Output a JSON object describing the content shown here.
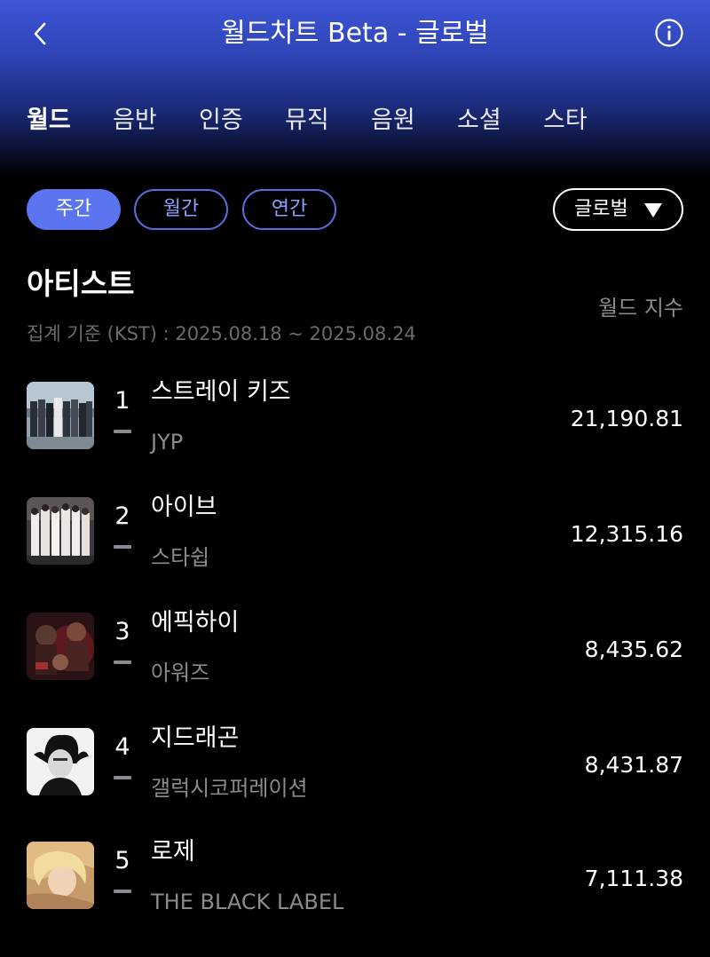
{
  "header": {
    "title": "월드차트 Beta - 글로벌"
  },
  "tabs": [
    {
      "label": "월드"
    },
    {
      "label": "음반"
    },
    {
      "label": "인증"
    },
    {
      "label": "뮤직"
    },
    {
      "label": "음원"
    },
    {
      "label": "소셜"
    },
    {
      "label": "스타"
    }
  ],
  "period_filter": {
    "options": [
      "주간",
      "월간",
      "연간"
    ],
    "selected": "주간"
  },
  "region_dropdown": {
    "value": "글로벌"
  },
  "section": {
    "title": "아티스트",
    "period_text": "집계 기준 (KST) : 2025.08.18 ~ 2025.08.24",
    "column_header": "월드 지수"
  },
  "rows": [
    {
      "rank": "1",
      "name": "스트레이 키즈",
      "agency": "JYP",
      "score": "21,190.81"
    },
    {
      "rank": "2",
      "name": "아이브",
      "agency": "스타쉽",
      "score": "12,315.16"
    },
    {
      "rank": "3",
      "name": "에픽하이",
      "agency": "아워즈",
      "score": "8,435.62"
    },
    {
      "rank": "4",
      "name": "지드래곤",
      "agency": "갤럭시코퍼레이션",
      "score": "8,431.87"
    },
    {
      "rank": "5",
      "name": "로제",
      "agency": "THE BLACK LABEL",
      "score": "7,111.38"
    }
  ],
  "colors": {
    "accent": "#5b74f0",
    "header_gradient_top": "#3d55d6",
    "background": "#000000",
    "muted_text": "#8a8a92"
  }
}
